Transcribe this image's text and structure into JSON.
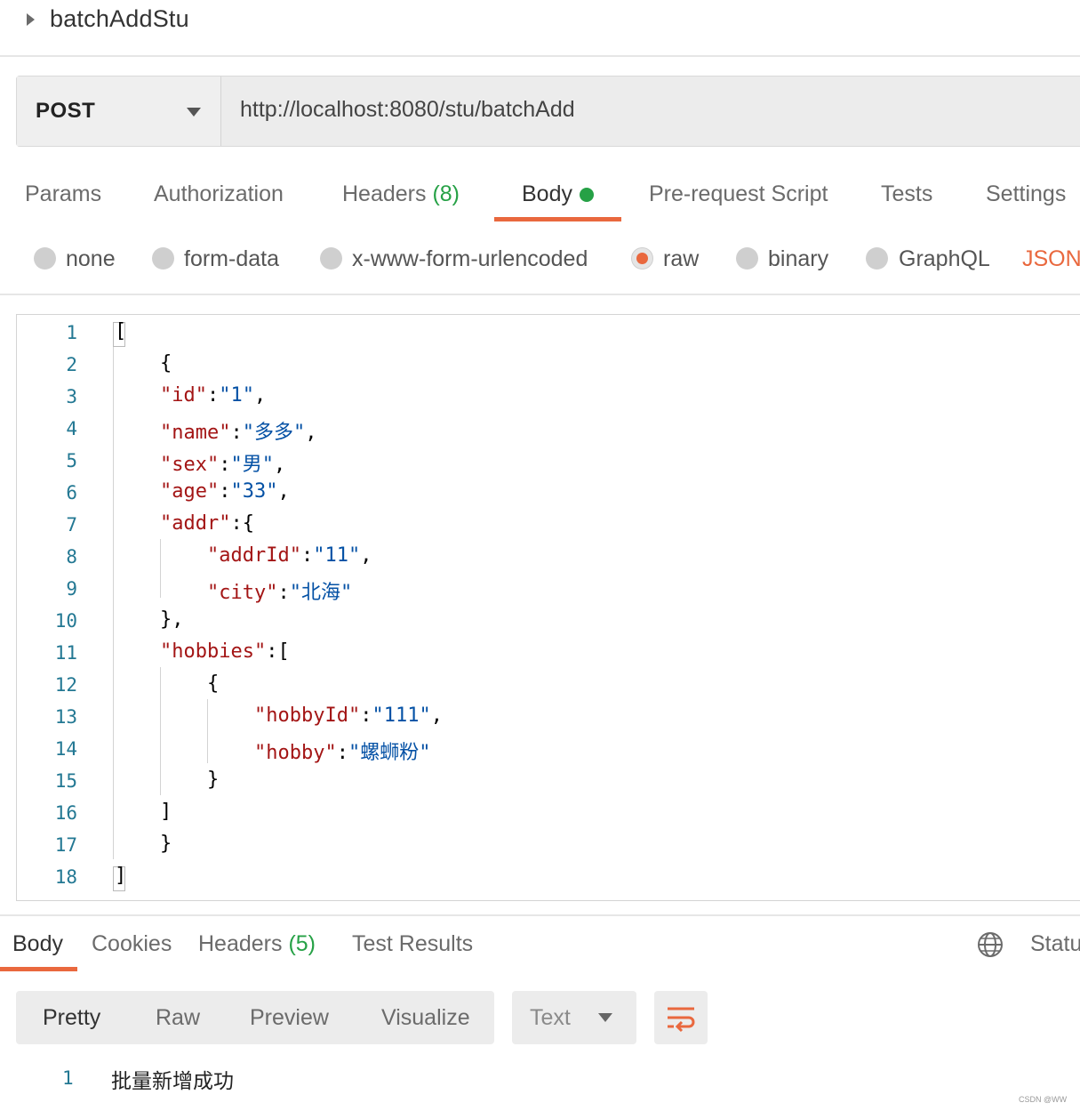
{
  "request": {
    "name": "batchAddStu",
    "method": "POST",
    "url": "http://localhost:8080/stu/batchAdd"
  },
  "request_tabs": {
    "params": "Params",
    "authorization": "Authorization",
    "headers": "Headers",
    "headers_count": "(8)",
    "body": "Body",
    "pre_request": "Pre-request Script",
    "tests": "Tests",
    "settings": "Settings",
    "active": "Body"
  },
  "body_modes": {
    "none": "none",
    "form_data": "form-data",
    "urlencoded": "x-www-form-urlencoded",
    "raw": "raw",
    "binary": "binary",
    "graphql": "GraphQL",
    "selected": "raw",
    "language": "JSON"
  },
  "editor": {
    "line_numbers": [
      "1",
      "2",
      "3",
      "4",
      "5",
      "6",
      "7",
      "8",
      "9",
      "10",
      "11",
      "12",
      "13",
      "14",
      "15",
      "16",
      "17",
      "18"
    ],
    "tokens": {
      "l1_open": "[",
      "l2": "{",
      "l3_key": "\"id\"",
      "l3_val": "\"1\"",
      "l4_key": "\"name\"",
      "l4_val": "\"多多\"",
      "l5_key": "\"sex\"",
      "l5_val": "\"男\"",
      "l6_key": "\"age\"",
      "l6_val": "\"33\"",
      "l7_key": "\"addr\"",
      "l7_open": "{",
      "l8_key": "\"addrId\"",
      "l8_val": "\"11\"",
      "l9_key": "\"city\"",
      "l9_val": "\"北海\"",
      "l10": "},",
      "l11_key": "\"hobbies\"",
      "l11_open": "[",
      "l12": "{",
      "l13_key": "\"hobbyId\"",
      "l13_val": "\"111\"",
      "l14_key": "\"hobby\"",
      "l14_val": "\"螺蛳粉\"",
      "l15": "}",
      "l16": "]",
      "l17": "}",
      "l18_close": "]",
      "colon": ":",
      "comma": ","
    }
  },
  "response_tabs": {
    "body": "Body",
    "cookies": "Cookies",
    "headers": "Headers",
    "headers_count": "(5)",
    "test_results": "Test Results",
    "status": "Status",
    "active": "Body"
  },
  "response_toolbar": {
    "views": [
      "Pretty",
      "Raw",
      "Preview",
      "Visualize"
    ],
    "selected_view": "Pretty",
    "format": "Text",
    "icons": [
      "globe-icon",
      "wrap-lines-icon"
    ]
  },
  "response_body": {
    "line_number": "1",
    "text": "批量新增成功"
  },
  "watermark": "CSDN @WW",
  "colors": {
    "accent": "#e9683e",
    "success": "#26a146",
    "json_key": "#a31515",
    "json_string": "#0451a5",
    "line_number": "#237893"
  }
}
